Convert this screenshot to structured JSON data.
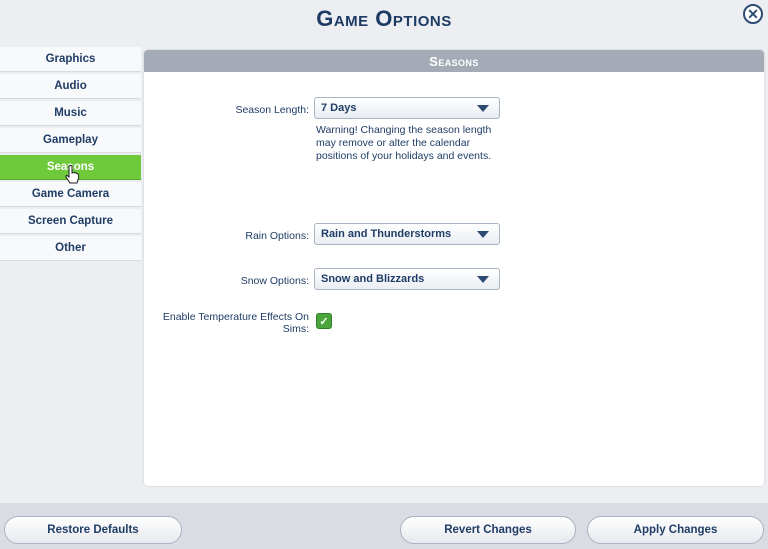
{
  "window": {
    "title": "Game Options",
    "close_icon": "close-icon"
  },
  "sidebar": {
    "items": [
      {
        "label": "Graphics",
        "active": false
      },
      {
        "label": "Audio",
        "active": false
      },
      {
        "label": "Music",
        "active": false
      },
      {
        "label": "Gameplay",
        "active": false
      },
      {
        "label": "Seasons",
        "active": true
      },
      {
        "label": "Game Camera",
        "active": false
      },
      {
        "label": "Screen Capture",
        "active": false
      },
      {
        "label": "Other",
        "active": false
      }
    ],
    "active_color": "#6ec93b"
  },
  "panel": {
    "header": "Seasons",
    "season_length": {
      "label": "Season Length:",
      "value": "7 Days",
      "warning": "Warning! Changing the season length may remove or alter the calendar positions of your holidays and events."
    },
    "rain_options": {
      "label": "Rain Options:",
      "value": "Rain and Thunderstorms"
    },
    "snow_options": {
      "label": "Snow Options:",
      "value": "Snow and Blizzards"
    },
    "temperature": {
      "label": "Enable Temperature Effects On Sims:",
      "checked": true
    }
  },
  "footer": {
    "restore_defaults": "Restore Defaults",
    "revert_changes": "Revert Changes",
    "apply_changes": "Apply Changes"
  }
}
